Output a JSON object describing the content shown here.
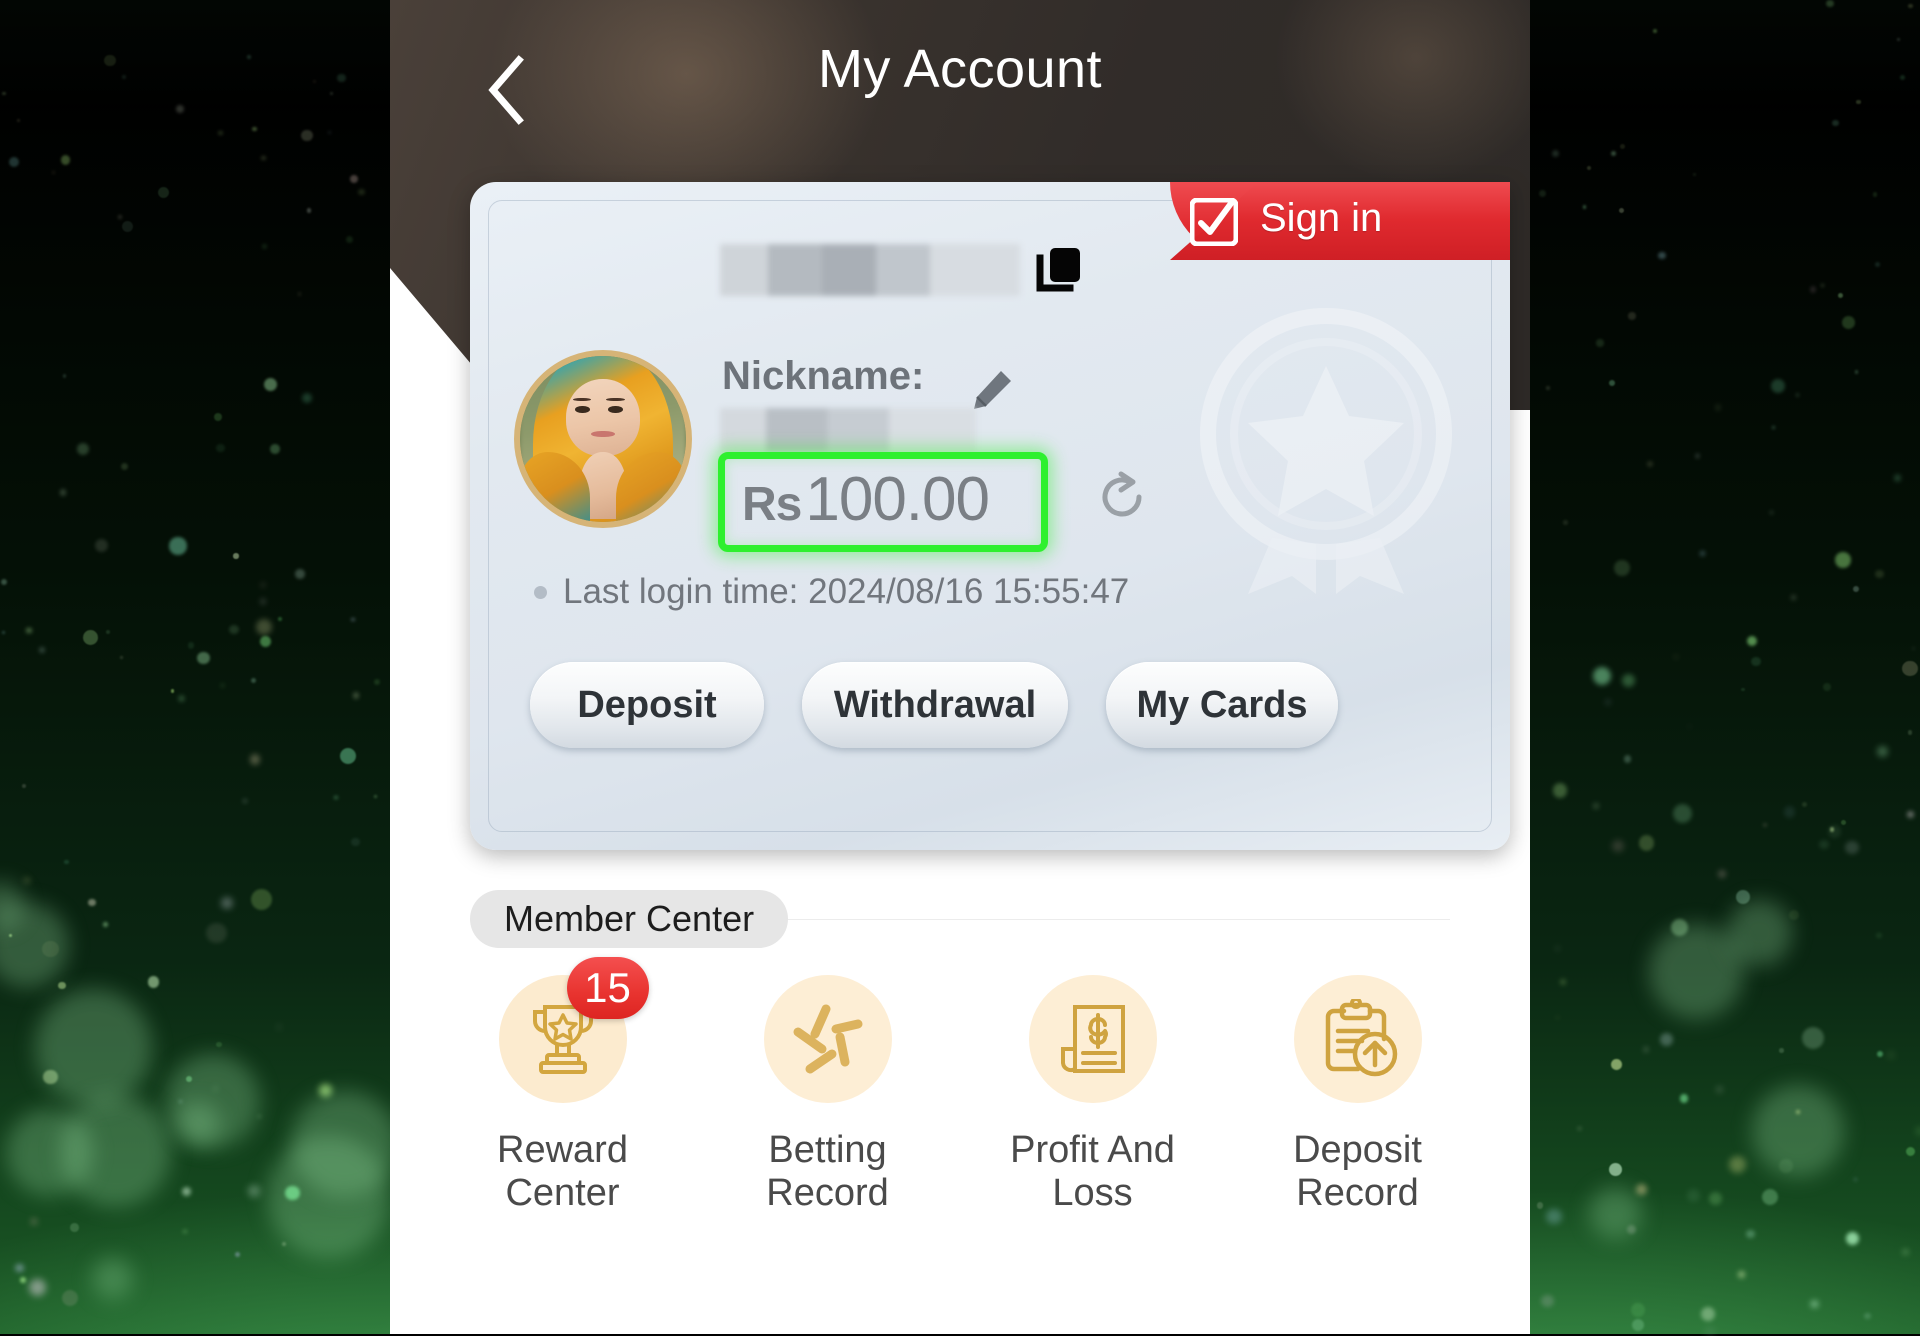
{
  "background": {
    "theme_color": "#1d5c27"
  },
  "header": {
    "title": "My Account",
    "back_icon": "chevron-left-icon"
  },
  "signin": {
    "label": "Sign in",
    "check_icon": "checkbox-checked-icon",
    "chevron_icon": "chevron-right-icon",
    "accent_color": "#e02a2f"
  },
  "account": {
    "avatar_alt": "user-avatar",
    "username_masked": "",
    "copy_icon": "copy-icon",
    "nickname_label": "Nickname:",
    "nickname_masked": "",
    "edit_icon": "pencil-icon",
    "balance_currency": "Rs",
    "balance_amount": "100.00",
    "refresh_icon": "refresh-icon",
    "highlight_color": "#2ef02e",
    "last_login_text": "Last login time: 2024/08/16 15:55:47",
    "buttons": [
      {
        "label": "Deposit",
        "name": "deposit-button"
      },
      {
        "label": "Withdrawal",
        "name": "withdrawal-button"
      },
      {
        "label": "My Cards",
        "name": "my-cards-button"
      }
    ]
  },
  "member_center": {
    "section_label": "Member Center",
    "items": [
      {
        "label": "Reward Center",
        "icon": "trophy-icon",
        "badge": "15"
      },
      {
        "label": "Betting Record",
        "icon": "betting-sticks-icon",
        "badge": ""
      },
      {
        "label": "Profit And Loss",
        "icon": "invoice-dollar-icon",
        "badge": ""
      },
      {
        "label": "Deposit Record",
        "icon": "clipboard-upload-icon",
        "badge": ""
      }
    ],
    "badge_color": "#e8332f",
    "icon_color": "#d3a63f"
  }
}
